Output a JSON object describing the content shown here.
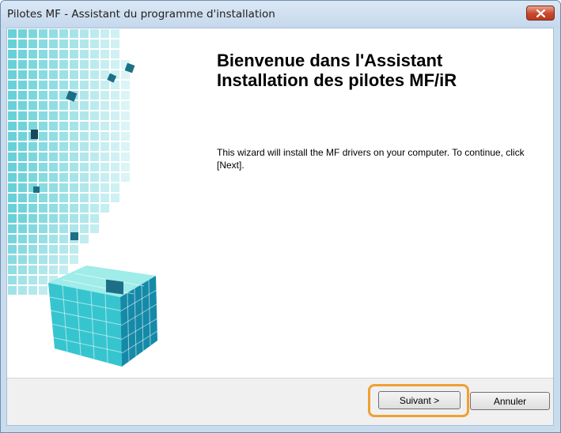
{
  "window": {
    "title": "Pilotes MF - Assistant du programme d'installation"
  },
  "content": {
    "heading_line1": "Bienvenue dans l'Assistant",
    "heading_line2": "Installation des pilotes MF/iR",
    "description": "This wizard will install the MF drivers on your computer. To continue, click [Next]."
  },
  "buttons": {
    "next_label": "Suivant >",
    "cancel_label": "Annuler"
  },
  "icons": {
    "close": "close-icon",
    "illustration": "cube-graphic"
  },
  "colors": {
    "accent_cyan": "#2cc4d0",
    "highlight_orange": "#f0a033",
    "close_red": "#c7482c"
  }
}
